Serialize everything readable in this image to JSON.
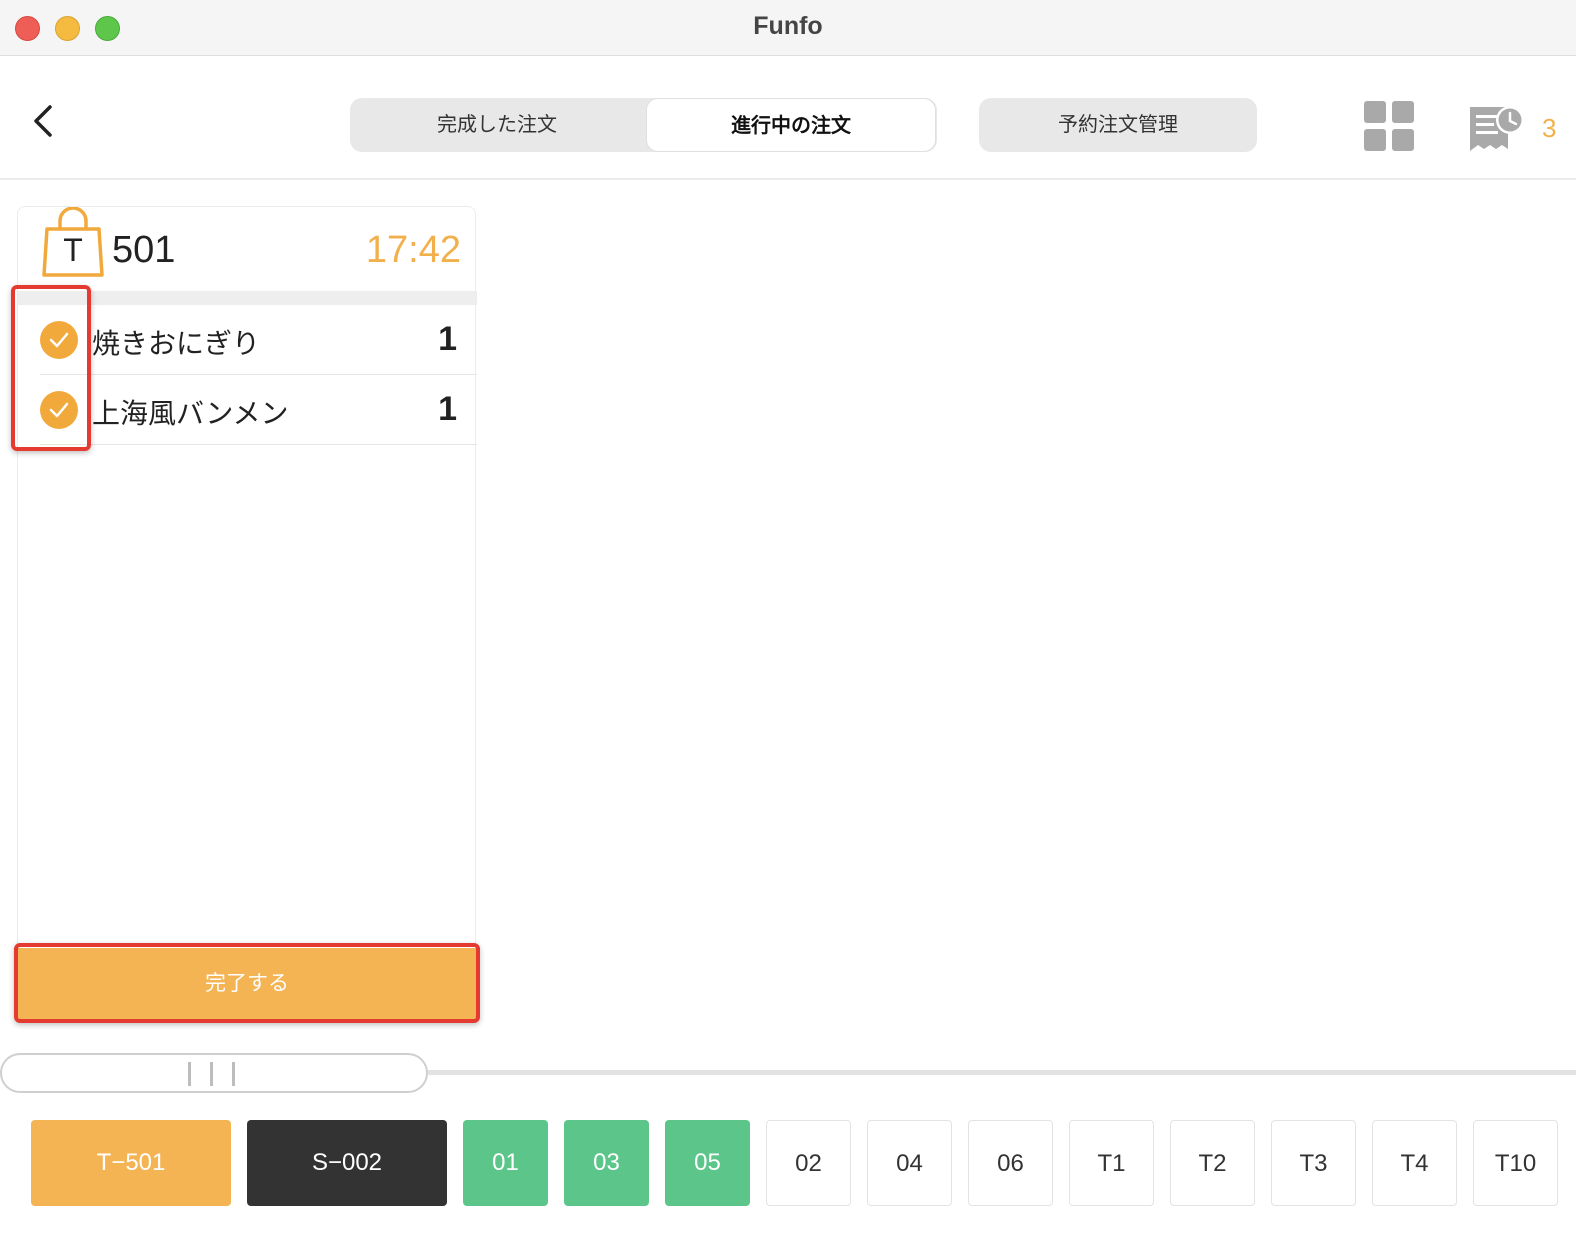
{
  "window": {
    "title": "Funfo"
  },
  "header": {
    "tabs": [
      {
        "label": "完成した注文",
        "active": false
      },
      {
        "label": "進行中の注文",
        "active": true
      }
    ],
    "reserve_label": "予約注文管理",
    "receipt_count": "3",
    "icons": [
      "chevron-left-icon",
      "grid-icon",
      "receipt-clock-icon"
    ]
  },
  "order": {
    "bag_letter": "T",
    "number": "501",
    "time": "17:42",
    "items": [
      {
        "name": "焼きおにぎり",
        "qty": "1",
        "checked": true
      },
      {
        "name": "上海風バンメン",
        "qty": "1",
        "checked": true
      }
    ],
    "complete_label": "完了する"
  },
  "tables": [
    {
      "label": "T−501",
      "state": "orange"
    },
    {
      "label": "S−002",
      "state": "dark"
    },
    {
      "label": "01",
      "state": "green"
    },
    {
      "label": "03",
      "state": "green"
    },
    {
      "label": "05",
      "state": "green"
    },
    {
      "label": "02",
      "state": "plain"
    },
    {
      "label": "04",
      "state": "plain"
    },
    {
      "label": "06",
      "state": "plain"
    },
    {
      "label": "T1",
      "state": "plain"
    },
    {
      "label": "T2",
      "state": "plain"
    },
    {
      "label": "T3",
      "state": "plain"
    },
    {
      "label": "T4",
      "state": "plain"
    },
    {
      "label": "T10",
      "state": "plain"
    }
  ],
  "colors": {
    "accent": "#f4b454",
    "green": "#5bc58a",
    "dark": "#333333",
    "highlight": "#e43a2f"
  }
}
